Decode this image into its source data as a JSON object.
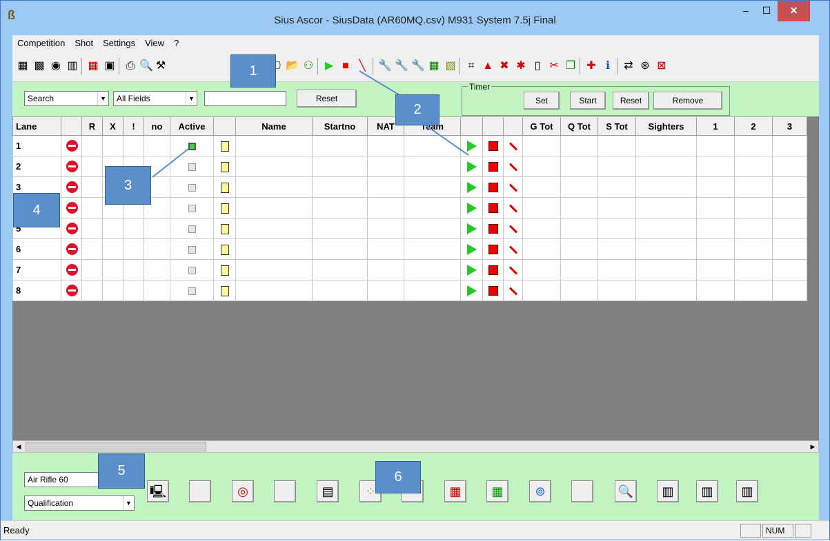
{
  "window": {
    "title": "Sius Ascor - SiusData  (AR60MQ.csv)  M931 System 7.5j Final",
    "min_glyph": "–",
    "max_glyph": "☐",
    "close_glyph": "✕"
  },
  "menu": [
    "Competition",
    "Shot",
    "Settings",
    "View",
    "?"
  ],
  "search": {
    "mode": "Search",
    "field": "All Fields",
    "query": "",
    "reset": "Reset"
  },
  "timer": {
    "label": "Timer",
    "set": "Set",
    "start": "Start",
    "reset": "Reset",
    "remove": "Remove"
  },
  "columns": [
    "Lane",
    "",
    "R",
    "X",
    "!",
    "no",
    "Active",
    "",
    "Name",
    "Startno",
    "NAT",
    "Team",
    "",
    "",
    "",
    "G Tot",
    "Q Tot",
    "S Tot",
    "Sighters",
    "1",
    "2",
    "3"
  ],
  "lanes": [
    "1",
    "2",
    "3",
    "4",
    "5",
    "6",
    "7",
    "8"
  ],
  "active_lane": "1",
  "event": "Air Rifle 60",
  "phase": "Qualification",
  "callouts": [
    "1",
    "2",
    "3",
    "4",
    "5",
    "6"
  ],
  "status": {
    "text": "Ready",
    "num": "NUM"
  },
  "colors": {
    "client_bg": "#c3f5c3",
    "title_bg": "#9ccaf4",
    "callout": "#5b8fcb",
    "grid_empty": "#808080"
  }
}
